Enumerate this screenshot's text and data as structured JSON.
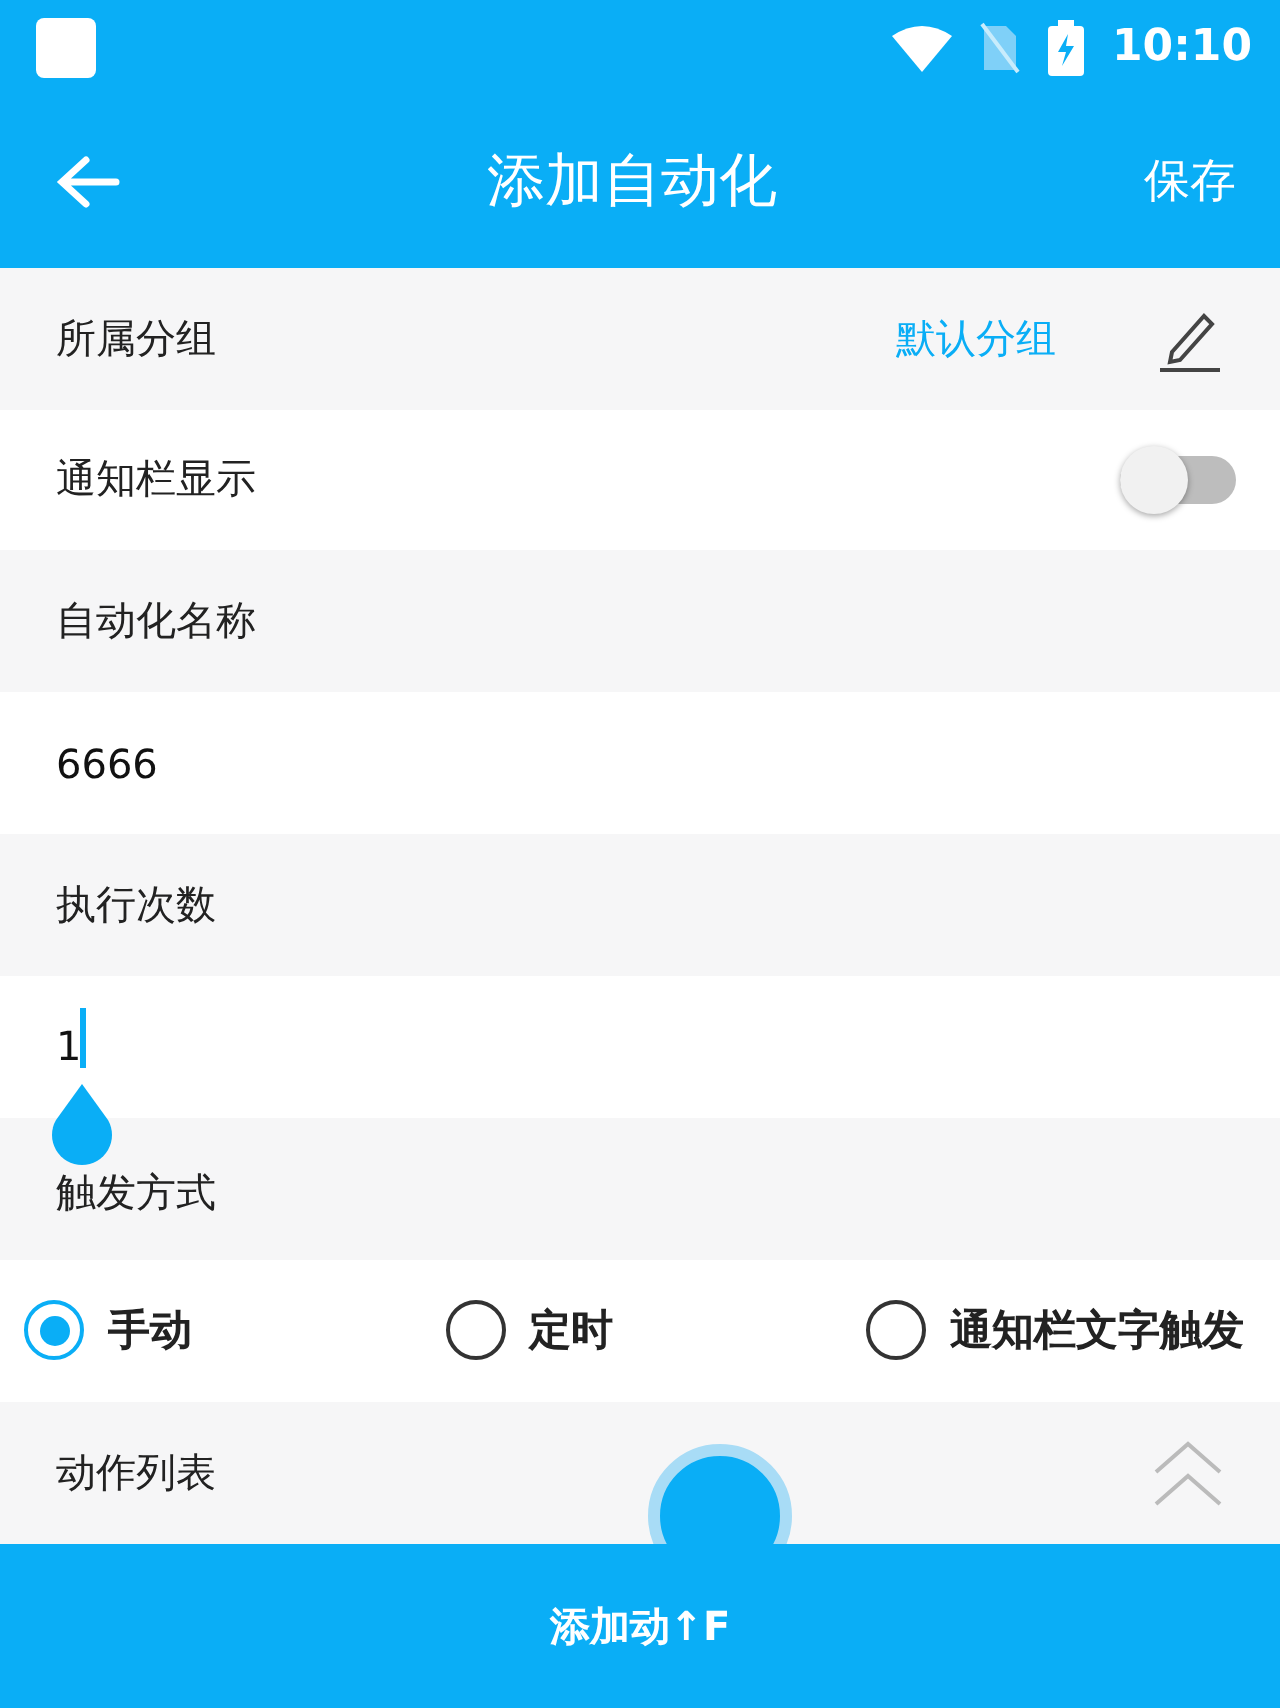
{
  "status_bar": {
    "time": "10:10"
  },
  "app_bar": {
    "title": "添加自动化",
    "action": "保存"
  },
  "group": {
    "label": "所属分组",
    "value": "默认分组"
  },
  "notification": {
    "label": "通知栏显示",
    "on": false
  },
  "name": {
    "label": "自动化名称",
    "value": "6666"
  },
  "count": {
    "label": "执行次数",
    "value": "1",
    "focused": true
  },
  "trigger": {
    "label": "触发方式",
    "options": [
      {
        "label": "手动",
        "selected": true
      },
      {
        "label": "定时",
        "selected": false
      },
      {
        "label": "通知栏文字触发",
        "selected": false
      }
    ]
  },
  "actions": {
    "label": "动作列表",
    "expanded": true
  },
  "add_button": "添加动↑F"
}
